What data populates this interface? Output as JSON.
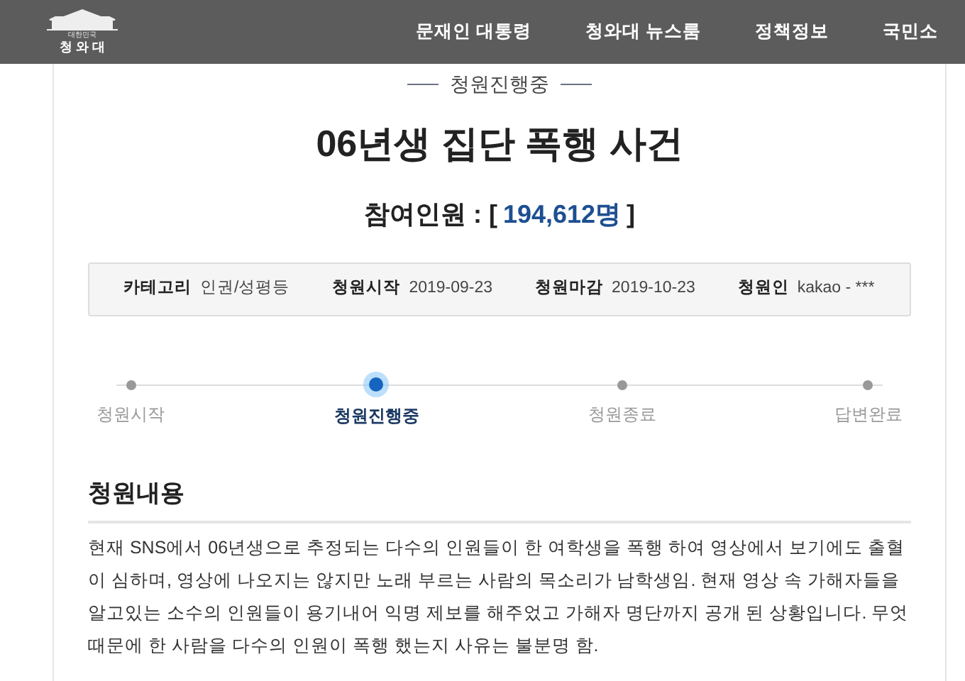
{
  "header": {
    "logo": {
      "caption": "청 와 대",
      "subcaption": "대한민국"
    },
    "nav": [
      "문재인 대통령",
      "청와대 뉴스룸",
      "정책정보",
      "국민소"
    ]
  },
  "petition": {
    "status": "청원진행중",
    "title": "06년생 집단 폭행 사건",
    "participants": {
      "label": "참여인원 : [",
      "count": "194,612명",
      "close": "]"
    },
    "info": [
      {
        "label": "카테고리",
        "value": "인권/성평등"
      },
      {
        "label": "청원시작",
        "value": "2019-09-23"
      },
      {
        "label": "청원마감",
        "value": "2019-10-23"
      },
      {
        "label": "청원인",
        "value": "kakao - ***"
      }
    ],
    "steps": [
      {
        "label": "청원시작",
        "selected": false
      },
      {
        "label": "청원진행중",
        "selected": true
      },
      {
        "label": "청원종료",
        "selected": false
      },
      {
        "label": "답변완료",
        "selected": false
      }
    ],
    "content": {
      "heading": "청원내용",
      "text": "현재 SNS에서 06년생으로 추정되는 다수의 인원들이 한 여학생을 폭행 하여 영상에서 보기에도 출혈이 심하며, 영상에 나오지는 않지만 노래 부르는 사람의 목소리가 남학생임. 현재 영상 속 가해자들을 알고있는 소수의 인원들이 용기내어 익명 제보를 해주었고 가해자 명단까지 공개 된 상황입니다. 무엇 때문에 한 사람을 다수의 인원이 폭행 했는지 사유는 불분명 함."
    }
  }
}
